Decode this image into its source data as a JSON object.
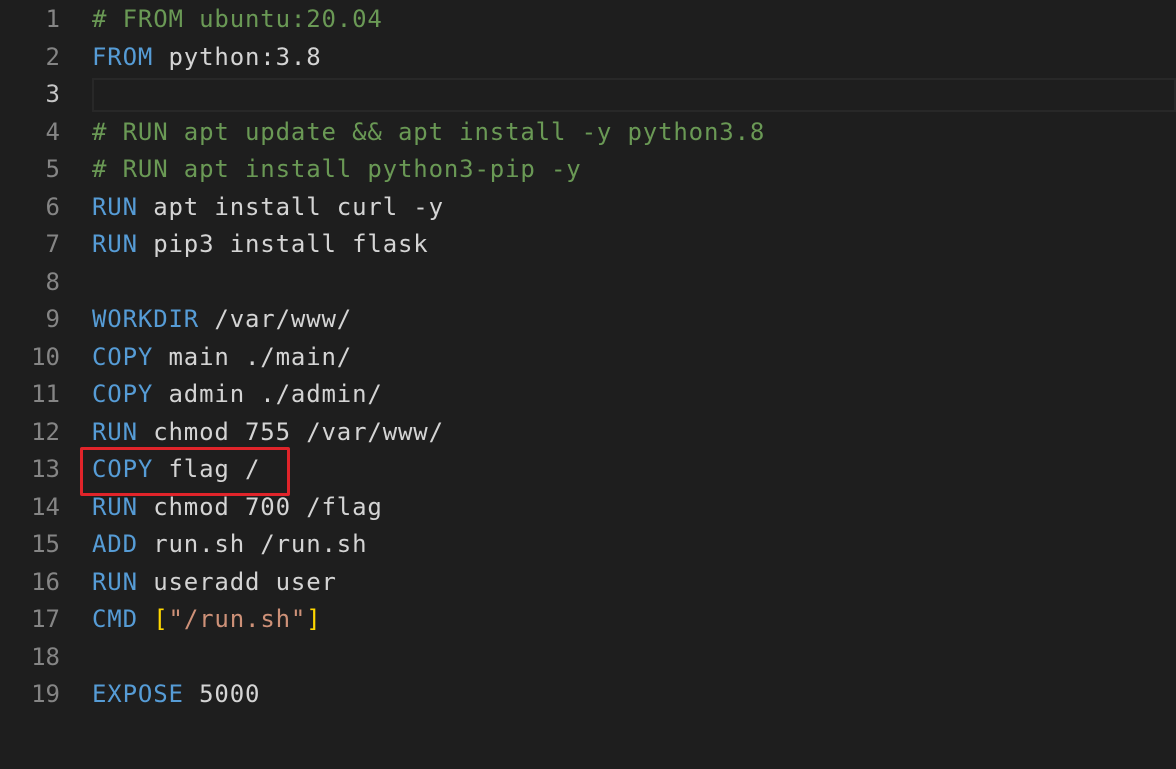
{
  "editor": {
    "active_line": 3,
    "colors": {
      "keyword": "#569cd6",
      "text": "#d4d4d4",
      "comment": "#6a9955",
      "string": "#ce9178",
      "bracket": "#ffd700"
    },
    "highlighted_line": 13,
    "lines": [
      {
        "n": "1",
        "tokens": [
          {
            "t": "# FROM ubuntu:20.04",
            "c": "comment"
          }
        ]
      },
      {
        "n": "2",
        "tokens": [
          {
            "t": "FROM",
            "c": "keyword"
          },
          {
            "t": " python:3.8",
            "c": "text"
          }
        ]
      },
      {
        "n": "3",
        "tokens": []
      },
      {
        "n": "4",
        "tokens": [
          {
            "t": "# RUN apt update && apt install -y python3.8",
            "c": "comment"
          }
        ]
      },
      {
        "n": "5",
        "tokens": [
          {
            "t": "# RUN apt install python3-pip -y",
            "c": "comment"
          }
        ]
      },
      {
        "n": "6",
        "tokens": [
          {
            "t": "RUN",
            "c": "keyword"
          },
          {
            "t": " apt install curl -y",
            "c": "text"
          }
        ]
      },
      {
        "n": "7",
        "tokens": [
          {
            "t": "RUN",
            "c": "keyword"
          },
          {
            "t": " pip3 install flask",
            "c": "text"
          }
        ]
      },
      {
        "n": "8",
        "tokens": []
      },
      {
        "n": "9",
        "tokens": [
          {
            "t": "WORKDIR",
            "c": "keyword"
          },
          {
            "t": " /var/www/",
            "c": "text"
          }
        ]
      },
      {
        "n": "10",
        "tokens": [
          {
            "t": "COPY",
            "c": "keyword"
          },
          {
            "t": " main ./main/",
            "c": "text"
          }
        ]
      },
      {
        "n": "11",
        "tokens": [
          {
            "t": "COPY",
            "c": "keyword"
          },
          {
            "t": " admin ./admin/",
            "c": "text"
          }
        ]
      },
      {
        "n": "12",
        "tokens": [
          {
            "t": "RUN",
            "c": "keyword"
          },
          {
            "t": " chmod 755 /var/www/",
            "c": "text"
          }
        ]
      },
      {
        "n": "13",
        "tokens": [
          {
            "t": "COPY",
            "c": "keyword"
          },
          {
            "t": " flag /",
            "c": "text"
          }
        ]
      },
      {
        "n": "14",
        "tokens": [
          {
            "t": "RUN",
            "c": "keyword"
          },
          {
            "t": " chmod 700 /flag",
            "c": "text"
          }
        ]
      },
      {
        "n": "15",
        "tokens": [
          {
            "t": "ADD",
            "c": "keyword"
          },
          {
            "t": " run.sh /run.sh",
            "c": "text"
          }
        ]
      },
      {
        "n": "16",
        "tokens": [
          {
            "t": "RUN",
            "c": "keyword"
          },
          {
            "t": " useradd user",
            "c": "text"
          }
        ]
      },
      {
        "n": "17",
        "tokens": [
          {
            "t": "CMD",
            "c": "keyword"
          },
          {
            "t": " ",
            "c": "text"
          },
          {
            "t": "[",
            "c": "bracket"
          },
          {
            "t": "\"/run.sh\"",
            "c": "string"
          },
          {
            "t": "]",
            "c": "bracket"
          }
        ]
      },
      {
        "n": "18",
        "tokens": []
      },
      {
        "n": "19",
        "tokens": [
          {
            "t": "EXPOSE",
            "c": "keyword"
          },
          {
            "t": " 5000",
            "c": "text"
          }
        ]
      }
    ]
  }
}
